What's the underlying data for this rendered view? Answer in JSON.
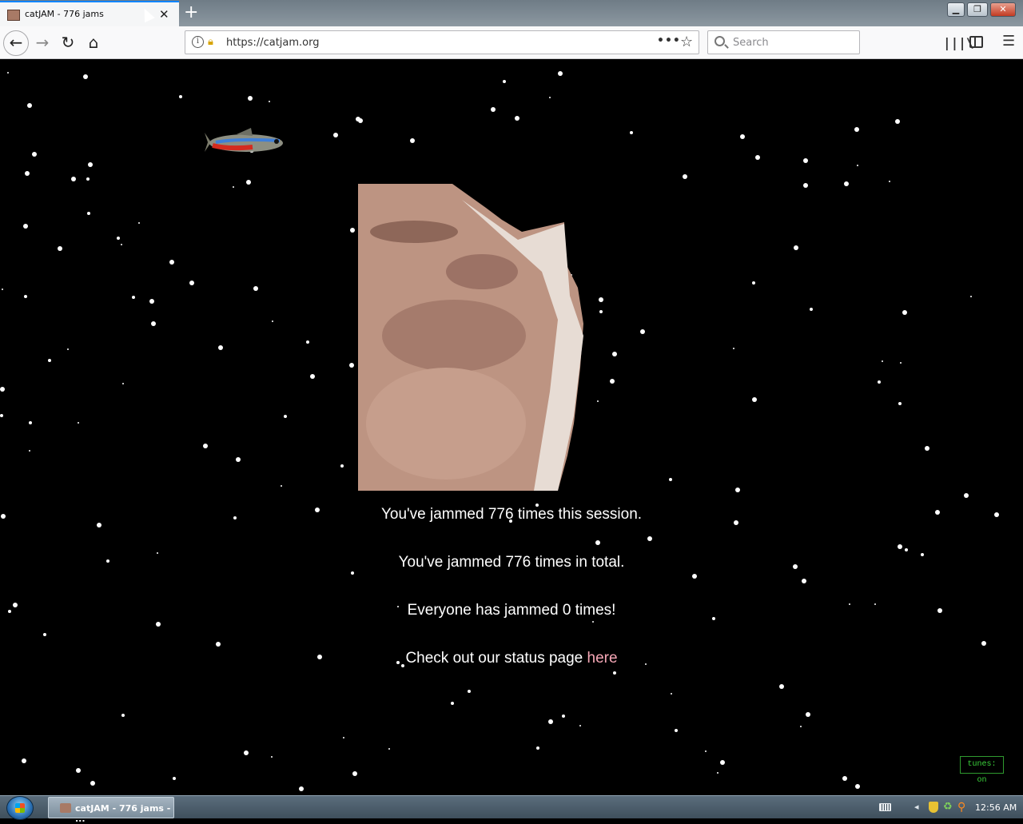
{
  "tab": {
    "title": "catJAM - 776 jams",
    "favicon": "catjam-favicon-icon",
    "close_icon": "close-icon"
  },
  "window": {
    "min_icon": "minimize-icon",
    "max_icon": "maximize-icon",
    "close_icon": "close-window-icon"
  },
  "nav": {
    "back_icon": "back-arrow-icon",
    "forward_icon": "forward-arrow-icon",
    "reload_icon": "reload-icon",
    "home_icon": "home-icon",
    "url": "https://catjam.org",
    "search_placeholder": "Search"
  },
  "page": {
    "session_text": "You've jammed 776 times this session.",
    "total_text": "You've jammed 776 times in total.",
    "everyone_text": "Everyone has jammed 0 times!",
    "status_prefix": "Check out our status page ",
    "status_link": "here",
    "tunes_label": "tunes: on",
    "link_color": "#f6a7b6",
    "tunes_color": "#3cd33c"
  },
  "taskbar": {
    "item_label": "catJAM - 776 jams - ...",
    "clock": "12:56 AM"
  }
}
